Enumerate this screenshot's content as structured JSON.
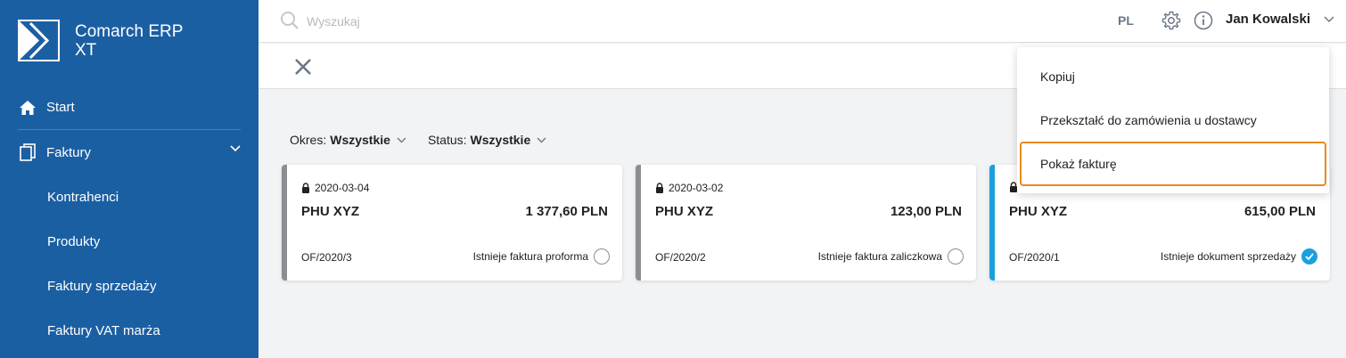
{
  "app": {
    "title_line1": "Comarch ERP",
    "title_line2": "XT"
  },
  "sidebar": {
    "items": [
      {
        "label": "Start",
        "icon": "home-icon"
      },
      {
        "label": "Faktury",
        "icon": "documents-icon"
      },
      {
        "label": "Kontrahenci"
      },
      {
        "label": "Produkty"
      },
      {
        "label": "Faktury sprzedaży"
      },
      {
        "label": "Faktury VAT marża"
      }
    ]
  },
  "topbar": {
    "search_placeholder": "Wyszukaj",
    "language": "PL",
    "user_name": "Jan Kowalski"
  },
  "filters": {
    "period_label": "Okres:",
    "period_value": "Wszystkie",
    "status_label": "Status:",
    "status_value": "Wszystkie"
  },
  "cards": [
    {
      "date": "2020-03-04",
      "name": "PHU XYZ",
      "amount": "1 377,60 PLN",
      "number": "OF/2020/3",
      "status": "Istnieje faktura proforma",
      "checked": false
    },
    {
      "date": "2020-03-02",
      "name": "PHU XYZ",
      "amount": "123,00 PLN",
      "number": "OF/2020/2",
      "status": "Istnieje faktura zaliczkowa",
      "checked": false
    },
    {
      "date": "",
      "name": "PHU XYZ",
      "amount": "615,00 PLN",
      "number": "OF/2020/1",
      "status": "Istnieje dokument sprzedaży",
      "checked": true
    }
  ],
  "context_menu": {
    "items": [
      "Kopiuj",
      "Przekształć do zamówienia u dostawcy",
      "Pokaż fakturę"
    ]
  },
  "colors": {
    "sidebar": "#1b5fa3",
    "accent": "#1aa0dc",
    "highlight": "#e98a1e"
  }
}
